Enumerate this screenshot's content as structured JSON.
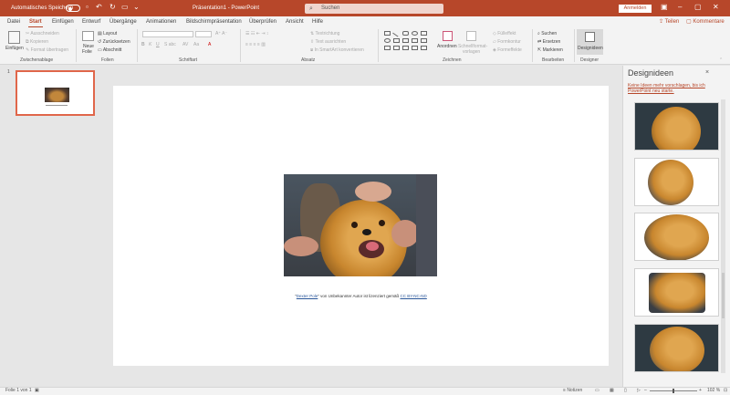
{
  "titlebar": {
    "autosave_label": "Automatisches Speichern",
    "autosave_toggle": "Aus",
    "doc_title": "Präsentation1 - PowerPoint",
    "search_placeholder": "Suchen",
    "signin_label": "Anmelden"
  },
  "tabs": [
    "Datei",
    "Start",
    "Einfügen",
    "Entwurf",
    "Übergänge",
    "Animationen",
    "Bildschirmpräsentation",
    "Überprüfen",
    "Ansicht",
    "Hilfe"
  ],
  "active_tab": "Start",
  "share": {
    "share_label": "Teilen",
    "comments_label": "Kommentare"
  },
  "ribbon": {
    "clipboard": {
      "paste_label": "Einfügen",
      "cut_label": "Ausschneiden",
      "copy_label": "Kopieren",
      "format_label": "Format übertragen",
      "group_label": "Zwischenablage"
    },
    "slides": {
      "new_label_1": "Neue",
      "new_label_2": "Folie",
      "layout_label": "Layout",
      "reset_label": "Zurücksetzen",
      "section_label": "Abschnitt",
      "group_label": "Folien"
    },
    "font": {
      "group_label": "Schriftart"
    },
    "paragraph": {
      "text_direction_label": "Textrichtung",
      "align_text_label": "Text ausrichten",
      "smartart_label": "In SmartArt konvertieren",
      "group_label": "Absatz"
    },
    "drawing": {
      "arrange_label": "Anordnen",
      "quickstyles_label_1": "Schnellformat-",
      "quickstyles_label_2": "vorlagen",
      "fill_label": "Fülleffekt",
      "outline_label": "Formkontur",
      "effects_label": "Formeffekte",
      "group_label": "Zeichnen"
    },
    "editing": {
      "find_label": "Suchen",
      "replace_label": "Ersetzen",
      "select_label": "Markieren",
      "group_label": "Bearbeiten"
    },
    "designer": {
      "label": "Designideen",
      "group_label": "Designer"
    }
  },
  "slide_panel": {
    "slide_number": "1"
  },
  "slide": {
    "caption_quote_open": "\"",
    "caption_link": "Dexter Pole",
    "caption_quote_close": "\"",
    "caption_mid": " von Unbekannter Autor ist lizenziert gemäß ",
    "caption_license": "CC BY-NC-ND"
  },
  "design_pane": {
    "title": "Designideen",
    "close_icon": "×",
    "link_text": "Keine Ideen mehr vorschlagen, bis ich PowerPoint neu starte."
  },
  "statusbar": {
    "slide_info": "Folie 1 von 1",
    "notes_label": "Notizen",
    "zoom": "102 %"
  },
  "colors": {
    "accent": "#b7472a",
    "link": "#2b579a"
  }
}
